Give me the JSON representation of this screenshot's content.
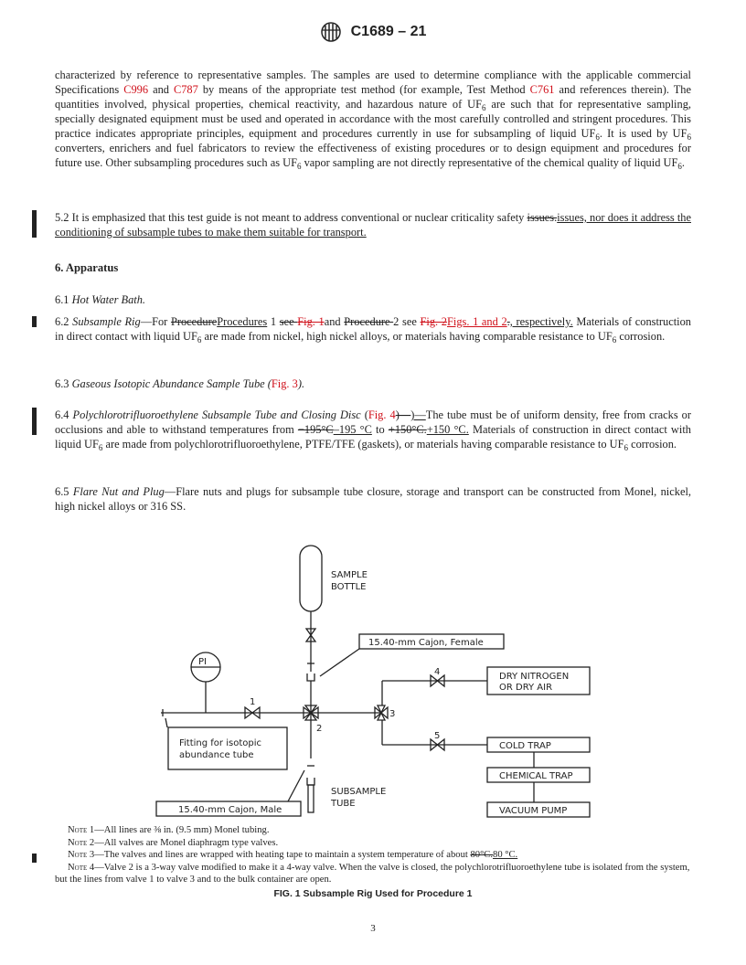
{
  "header": {
    "doc_id": "C1689 – 21"
  },
  "intro": {
    "t1": "characterized by reference to representative samples. The samples are used to determine compliance with the applicable commercial Specifications ",
    "link1": "C996",
    "t2": " and ",
    "link2": "C787",
    "t3": " by means of the appropriate test method (for example, Test Method ",
    "link3": "C761",
    "t4": " and references therein). The quantities involved, physical properties, chemical reactivity, and hazardous nature of UF",
    "t5": " are such that for representative sampling, specially designated equipment must be used and operated in accordance with the most carefully controlled and stringent procedures. This practice indicates appropriate principles, equipment and procedures currently in use for subsampling of liquid UF",
    "t6": ". It is used by UF",
    "t7": " converters, enrichers and fuel fabricators to review the effectiveness of existing procedures or to design equipment and procedures for future use. Other subsampling procedures such as UF",
    "t8": " vapor sampling are not directly representative of the chemical quality of liquid UF",
    "t9": ".",
    "sub": "6"
  },
  "s52": {
    "t1": "5.2 It is emphasized that this test guide is not meant to address conventional or nuclear criticality safety ",
    "deleted": "issues.",
    "inserted": "issues, nor does it address the conditioning of subsample tubes to make them suitable for transport."
  },
  "section6": {
    "heading": "6. Apparatus"
  },
  "s61": {
    "num": "6.1 ",
    "title": "Hot Water Bath."
  },
  "s62": {
    "num": "6.2 ",
    "title": "Subsample Rig",
    "dash": "—For ",
    "del1": "Procedure",
    "ins1": "Procedures",
    "t1": " 1 ",
    "del2": "see ",
    "del2red": "Fig. 1",
    "t2": "and ",
    "del3": "Procedure ",
    "t3": "2 see ",
    "del4red": "Fig. 2",
    "ins4red": "Figs. 1 and 2",
    "del5": ".",
    "ins5": ", respectively.",
    "t4": " Materials of construction in direct contact with liquid UF",
    "t5": " are made from nickel, high nickel alloys, or materials having comparable resistance to UF",
    "t6": " corrosion.",
    "sub": "6"
  },
  "s63": {
    "num": "6.3 ",
    "title": "Gaseous Isotopic Abundance Sample Tube (",
    "link": "Fig. 3",
    "end": ")."
  },
  "s64": {
    "num": "6.4 ",
    "title": "Polychlorotrifluoroethylene Subsample Tube and Closing Disc",
    "t0": " (",
    "link": "Fig. 4",
    "del0": ")—",
    "ins0": ")—",
    "t1": "The tube must be of uniform density, free from cracks or occlusions and able to withstand temperatures from ",
    "del1": "−195°C",
    "ins1": "–195 °C",
    "t2": " to ",
    "del2": "+150°C.",
    "ins2": "+150 °C.",
    "t3": " Materials of construction in direct contact with liquid UF",
    "t4": " are made from polychlorotrifluoroethylene, PTFE/TFE (gaskets), or materials having comparable resistance to UF",
    "t5": " corrosion.",
    "sub": "6"
  },
  "s65": {
    "num": "6.5 ",
    "title": "Flare Nut and Plug",
    "text": "—Flare nuts and plugs for subsample tube closure, storage and transport can be constructed from Monel, nickel, high nickel alloys or 316 SS."
  },
  "figure": {
    "sample_bottle": [
      "SAMPLE",
      "BOTTLE"
    ],
    "female_label": "15.40-mm Cajon, Female",
    "male_label": "15.40-mm Cajon, Male",
    "pi_label": "PI",
    "fitting_label": [
      "Fitting for isotopic",
      "abundance tube"
    ],
    "subsample_tube": [
      "SUBSAMPLE",
      "TUBE"
    ],
    "nitrogen": [
      "DRY NITROGEN",
      "OR DRY AIR"
    ],
    "cold_trap": "COLD TRAP",
    "chemical_trap": "CHEMICAL TRAP",
    "vacuum_pump": "VACUUM PUMP",
    "valve_labels": [
      "1",
      "2",
      "3",
      "4",
      "5"
    ]
  },
  "notes": {
    "note_word": "Note",
    "n1": " 1—All lines are ⅜ in. (9.5 mm) Monel tubing.",
    "n2": " 2—All valves are Monel diaphragm type valves.",
    "n3": " 3—The valves and lines are wrapped with heating tape to maintain a system temperature of about ",
    "n3del": "80°C.",
    "n3ins": "80 °C.",
    "n4": " 4—Valve 2 is a 3-way valve modified to make it a 4-way valve. When the valve is closed, the polychlorotrifluoroethylene tube is isolated from the system, but the lines from valve 1 to valve 3 and to the bulk container are open."
  },
  "caption": "FIG. 1 Subsample Rig Used for Procedure 1",
  "page_number": "3"
}
